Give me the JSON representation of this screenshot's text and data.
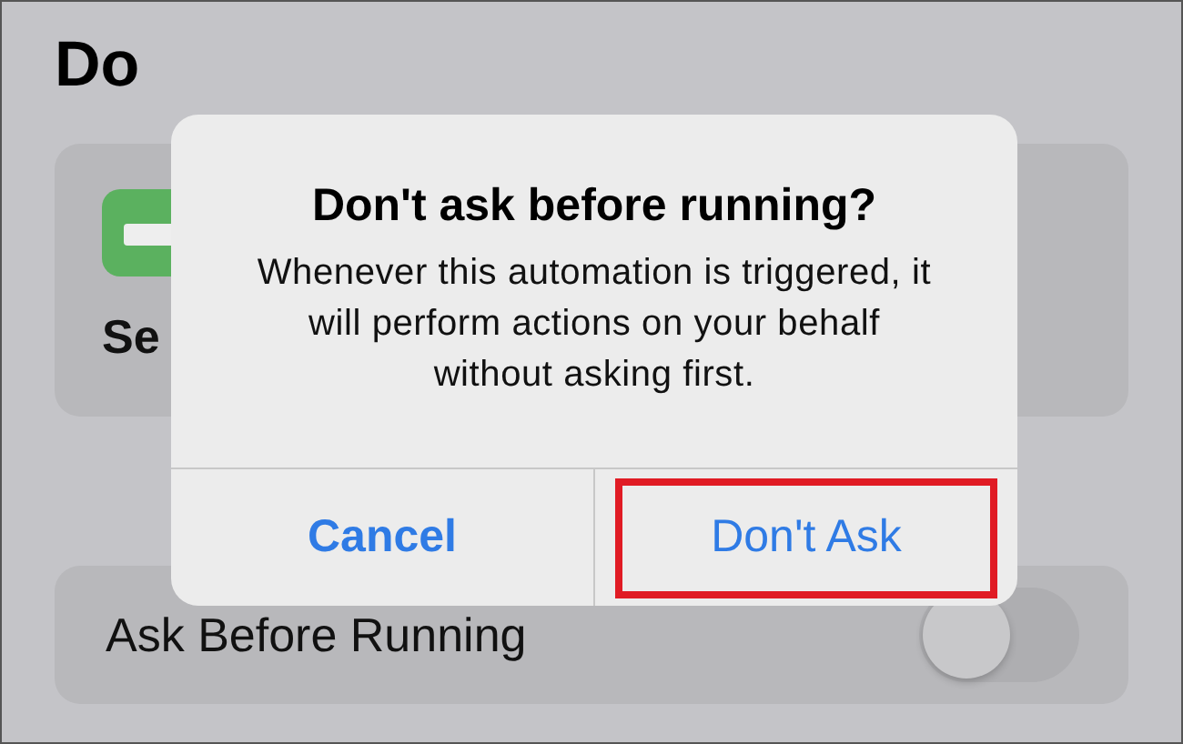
{
  "heading": "Do",
  "action_card": {
    "label": "Se"
  },
  "setting": {
    "label": "Ask Before Running",
    "on": false
  },
  "alert": {
    "title": "Don't ask before running?",
    "message": "Whenever this automation is triggered, it will perform actions on your behalf without asking first.",
    "buttons": [
      {
        "label": "Cancel",
        "bold": true,
        "highlighted": false
      },
      {
        "label": "Don't Ask",
        "bold": false,
        "highlighted": true
      }
    ]
  }
}
